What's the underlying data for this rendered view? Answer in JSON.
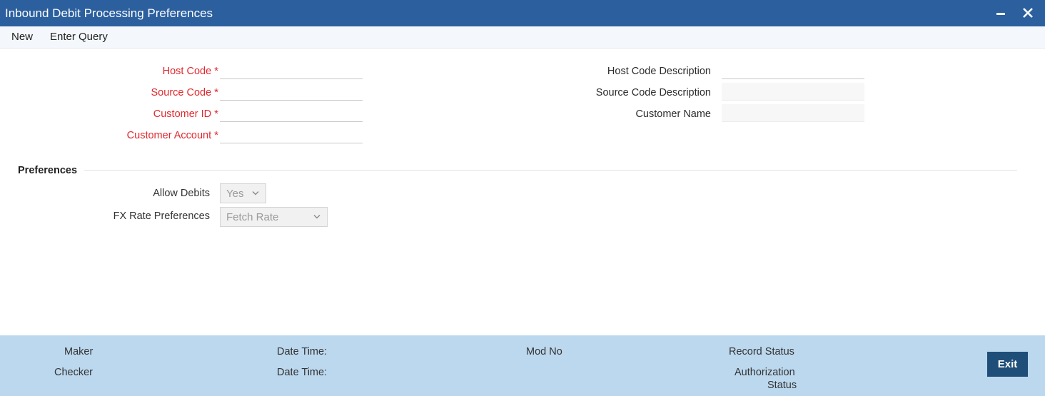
{
  "window": {
    "title": "Inbound Debit Processing Preferences"
  },
  "toolbar": {
    "new_label": "New",
    "enter_query_label": "Enter Query"
  },
  "form": {
    "host_code_label": "Host Code",
    "source_code_label": "Source Code",
    "customer_id_label": "Customer ID",
    "customer_account_label": "Customer Account",
    "required_mark": "*",
    "host_code_desc_label": "Host Code Description",
    "source_code_desc_label": "Source Code Description",
    "customer_name_label": "Customer Name"
  },
  "preferences": {
    "section_title": "Preferences",
    "allow_debits_label": "Allow Debits",
    "allow_debits_value": "Yes",
    "fx_rate_label": "FX Rate Preferences",
    "fx_rate_value": "Fetch Rate"
  },
  "footer": {
    "maker_label": "Maker",
    "checker_label": "Checker",
    "date_time_label": "Date Time:",
    "mod_no_label": "Mod No",
    "record_status_label": "Record Status",
    "authorization_label": "Authorization",
    "status_label": "Status",
    "exit_label": "Exit"
  },
  "colors": {
    "titlebar": "#2b5f9e",
    "required": "#e0282e",
    "footer": "#bcd8ee",
    "exit_button": "#1f4e78"
  }
}
